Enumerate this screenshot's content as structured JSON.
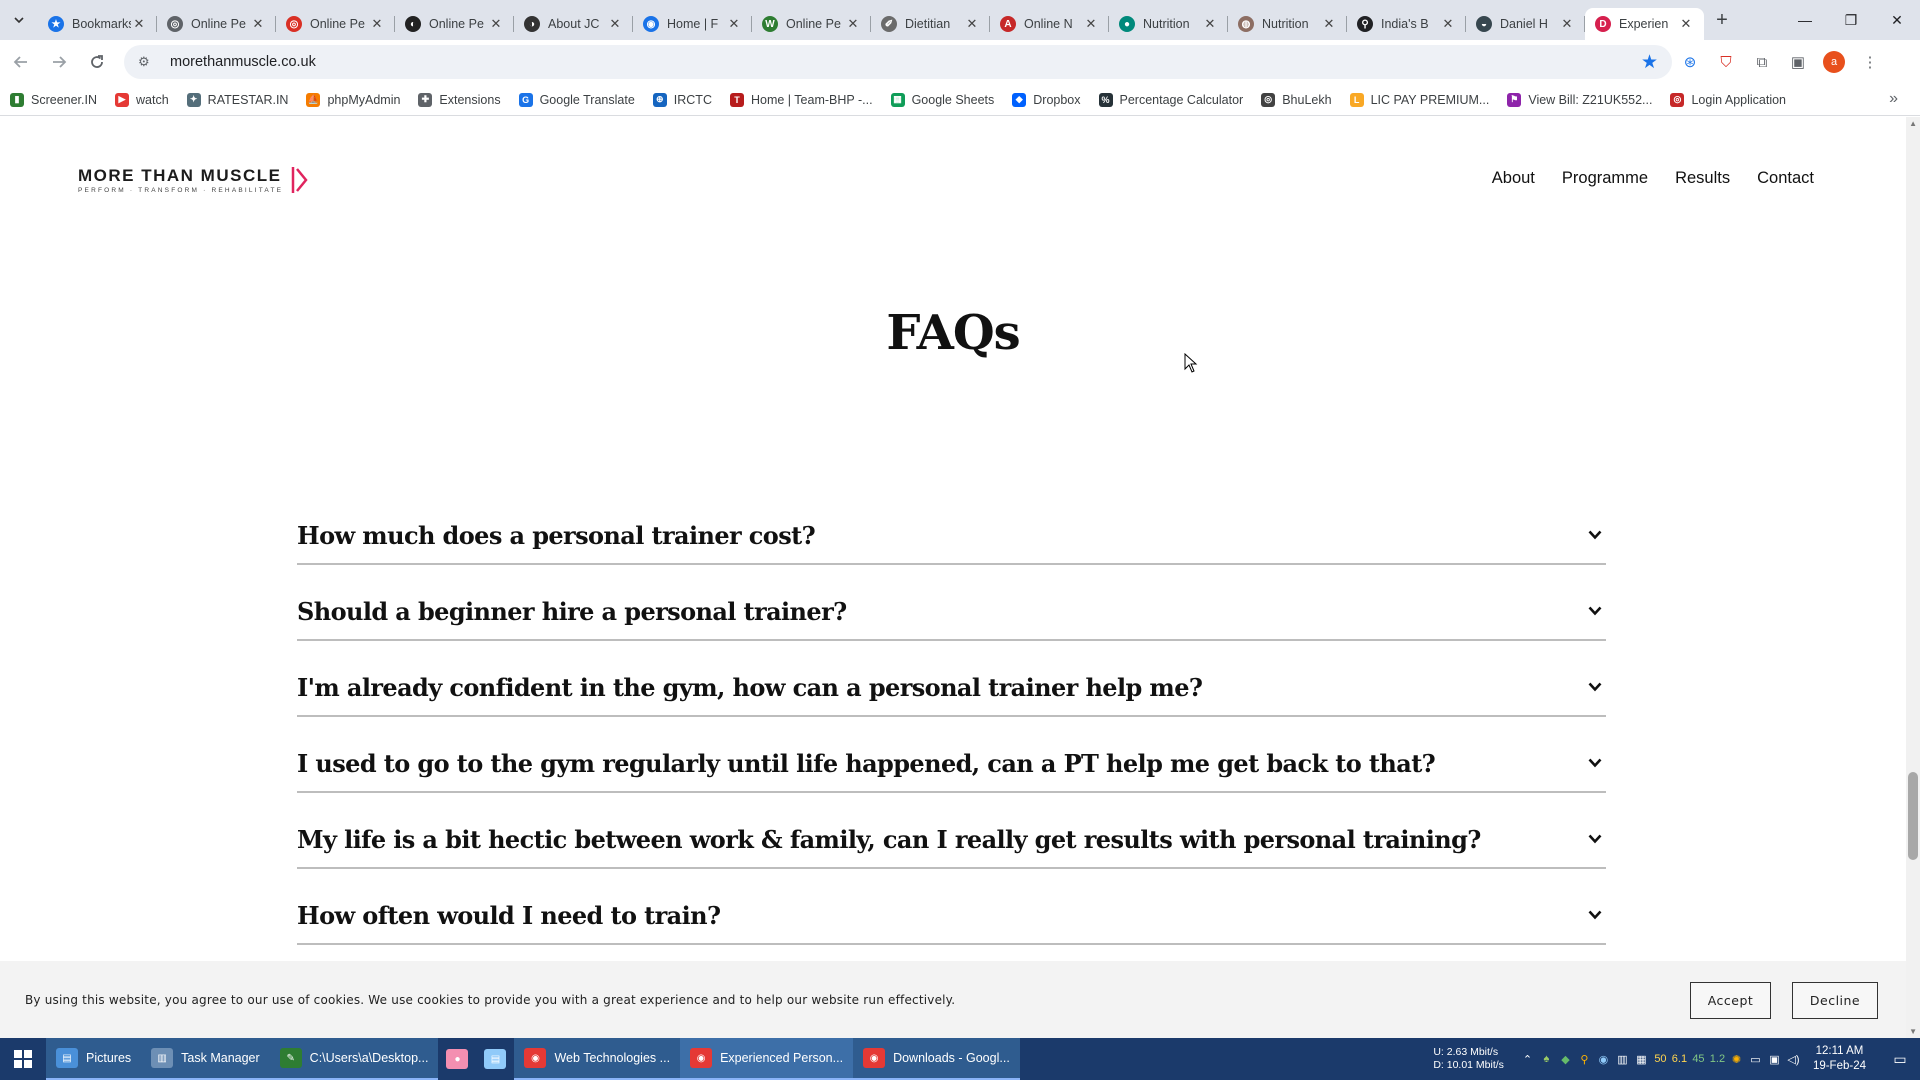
{
  "browser": {
    "tabs": [
      {
        "title": "Bookmarks",
        "fav_color": "#1a73e8",
        "fav_glyph": "★"
      },
      {
        "title": "Online Pe",
        "fav_color": "#5f6368",
        "fav_glyph": "◎"
      },
      {
        "title": "Online Pe",
        "fav_color": "#d93025",
        "fav_glyph": "◎"
      },
      {
        "title": "Online Pe",
        "fav_color": "#222222",
        "fav_glyph": "◐"
      },
      {
        "title": "About JC",
        "fav_color": "#333333",
        "fav_glyph": "◑"
      },
      {
        "title": "Home | F",
        "fav_color": "#1a73e8",
        "fav_glyph": "◉"
      },
      {
        "title": "Online Pe",
        "fav_color": "#2e7d32",
        "fav_glyph": "W"
      },
      {
        "title": "Dietitian",
        "fav_color": "#6b6b6b",
        "fav_glyph": "✐"
      },
      {
        "title": "Online N",
        "fav_color": "#c62828",
        "fav_glyph": "A"
      },
      {
        "title": "Nutrition",
        "fav_color": "#00897b",
        "fav_glyph": "●"
      },
      {
        "title": "Nutrition",
        "fav_color": "#8d6e63",
        "fav_glyph": "◍"
      },
      {
        "title": "India's B",
        "fav_color": "#202124",
        "fav_glyph": "⚲"
      },
      {
        "title": "Daniel H",
        "fav_color": "#37474f",
        "fav_glyph": "◒"
      },
      {
        "title": "Experien",
        "fav_color": "#d6204e",
        "fav_glyph": "D",
        "active": true
      }
    ],
    "url": "morethanmuscle.co.uk",
    "profile_initial": "a",
    "bookmarks": [
      {
        "label": "Screener.IN",
        "color": "#2e7d32",
        "glyph": "▮"
      },
      {
        "label": "watch",
        "color": "#e53935",
        "glyph": "▶"
      },
      {
        "label": "RATESTAR.IN",
        "color": "#546e7a",
        "glyph": "✦"
      },
      {
        "label": "phpMyAdmin",
        "color": "#f57c00",
        "glyph": "⛵"
      },
      {
        "label": "Extensions",
        "color": "#5f6368",
        "glyph": "✚"
      },
      {
        "label": "Google Translate",
        "color": "#1a73e8",
        "glyph": "G"
      },
      {
        "label": "IRCTC",
        "color": "#1565c0",
        "glyph": "⊕"
      },
      {
        "label": "Home | Team-BHP -...",
        "color": "#b71c1c",
        "glyph": "T"
      },
      {
        "label": "Google Sheets",
        "color": "#0f9d58",
        "glyph": "▦"
      },
      {
        "label": "Dropbox",
        "color": "#0061fe",
        "glyph": "◆"
      },
      {
        "label": "Percentage Calculator",
        "color": "#263238",
        "glyph": "%"
      },
      {
        "label": "BhuLekh",
        "color": "#424242",
        "glyph": "◎"
      },
      {
        "label": "LIC PAY PREMIUM...",
        "color": "#f9a825",
        "glyph": "L"
      },
      {
        "label": "View Bill: Z21UK552...",
        "color": "#8e24aa",
        "glyph": "⚑"
      },
      {
        "label": "Login Application",
        "color": "#c62828",
        "glyph": "◎"
      }
    ]
  },
  "site": {
    "logo_main": "MORE THAN MUSCLE",
    "logo_tagline": "PERFORM · TRANSFORM · REHABILITATE",
    "brand_color": "#e0245e",
    "nav": [
      "About",
      "Programme",
      "Results",
      "Contact"
    ],
    "faq_title": "FAQs",
    "faqs": [
      "How much does a personal trainer cost?",
      "Should a beginner hire a personal trainer?",
      "I'm already confident in the gym, how can a personal trainer help me?",
      "I used to go to the gym regularly until life happened, can a PT help me get back to that?",
      "My life is a bit hectic between work & family, can I really get results with personal training?",
      "How often would I need to train?"
    ],
    "cookie": {
      "text": "By using this website, you agree to our use of cookies. We use cookies to provide you with a great experience and to help our website run effectively.",
      "accept": "Accept",
      "decline": "Decline"
    }
  },
  "taskbar": {
    "items": [
      {
        "label": "Pictures",
        "state": "open",
        "color": "#4a90d9",
        "glyph": "▤"
      },
      {
        "label": "Task Manager",
        "state": "open",
        "color": "#6d8fb5",
        "glyph": "▥"
      },
      {
        "label": "C:\\Users\\a\\Desktop...",
        "state": "open",
        "color": "#2e7d32",
        "glyph": "✎"
      },
      {
        "label": "",
        "state": "icon",
        "color": "#f48fb1",
        "glyph": "●"
      },
      {
        "label": "",
        "state": "icon",
        "color": "#90caf9",
        "glyph": "▤"
      },
      {
        "label": "Web Technologies ...",
        "state": "open",
        "color": "#e53935",
        "glyph": "◉"
      },
      {
        "label": "Experienced Person...",
        "state": "active",
        "color": "#e53935",
        "glyph": "◉"
      },
      {
        "label": "Downloads - Googl...",
        "state": "open",
        "color": "#e53935",
        "glyph": "◉"
      }
    ],
    "net_up": "U:",
    "net_up_val": "2.63 Mbit/s",
    "net_down": "D:",
    "net_down_val": "10.01 Mbit/s",
    "tray_numbers": [
      "50",
      "6.1",
      "45",
      "1.2"
    ],
    "time": "12:11 AM",
    "date": "19-Feb-24"
  }
}
